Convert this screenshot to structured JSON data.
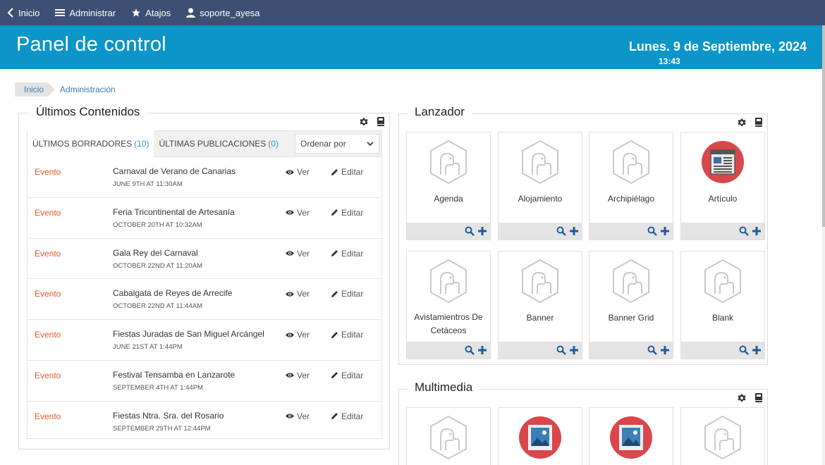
{
  "topbar": {
    "home_label": "Inicio",
    "admin_label": "Administrar",
    "shortcuts_label": "Atajos",
    "user_label": "soporte_ayesa"
  },
  "header": {
    "title": "Panel de control",
    "date": "Lunes. 9 de Septiembre, 2024",
    "time": "13:43"
  },
  "breadcrumb": {
    "home": "Inicio",
    "current": "Administración"
  },
  "latest": {
    "title": "Últimos Contenidos",
    "tab_drafts": "ÚLTIMOS BORRADORES",
    "tab_drafts_count": "(10)",
    "tab_published": "ÚLTIMAS PUBLICACIONES",
    "tab_published_count": "(0)",
    "sort_label": "Ordenar por",
    "view_label": "Ver",
    "edit_label": "Editar",
    "rows": [
      {
        "type": "Evento",
        "title": "Carnaval de Verano de Canarias",
        "date": "JUNE 9TH AT 11:30AM"
      },
      {
        "type": "Evento",
        "title": "Feria Tricontinental de Artesanía",
        "date": "OCTOBER 20TH AT 10:32AM"
      },
      {
        "type": "Evento",
        "title": "Gala Rey del Carnaval",
        "date": "OCTOBER 22ND AT 11:20AM"
      },
      {
        "type": "Evento",
        "title": "Cabalgata de Reyes de Arrecife",
        "date": "OCTOBER 22ND AT 11:44AM"
      },
      {
        "type": "Evento",
        "title": "Fiestas Juradas de San Miguel Arcángel",
        "date": "JUNE 21ST AT 1:44PM"
      },
      {
        "type": "Evento",
        "title": "Festival Tensamba en Lanzarote",
        "date": "SEPTEMBER 4TH AT 1:44PM"
      },
      {
        "type": "Evento",
        "title": "Fiestas Ntra. Sra. del Rosario",
        "date": "SEPTEMBER 29TH AT 12:44PM"
      }
    ]
  },
  "launcher": {
    "title": "Lanzador",
    "cards": [
      {
        "name": "Agenda",
        "icon": "structure-placeholder-icon"
      },
      {
        "name": "Alojamiento",
        "icon": "structure-placeholder-icon"
      },
      {
        "name": "Archipiélago",
        "icon": "structure-placeholder-icon"
      },
      {
        "name": "Artículo",
        "icon": "article-icon"
      },
      {
        "name": "Avistamientros De Cetáceos",
        "icon": "structure-placeholder-icon"
      },
      {
        "name": "Banner",
        "icon": "structure-placeholder-icon"
      },
      {
        "name": "Banner Grid",
        "icon": "structure-placeholder-icon"
      },
      {
        "name": "Blank",
        "icon": "structure-placeholder-icon"
      }
    ]
  },
  "multimedia": {
    "title": "Multimedia",
    "cards": [
      {
        "icon": "structure-placeholder-icon"
      },
      {
        "icon": "image-icon"
      },
      {
        "icon": "image-icon"
      },
      {
        "icon": "structure-placeholder-icon"
      }
    ]
  },
  "colors": {
    "topbar": "#3d4f72",
    "header": "#0b95c9",
    "accent_link": "#3b7cae",
    "event_type": "#e05a2b",
    "icon_red": "#d9474b"
  }
}
